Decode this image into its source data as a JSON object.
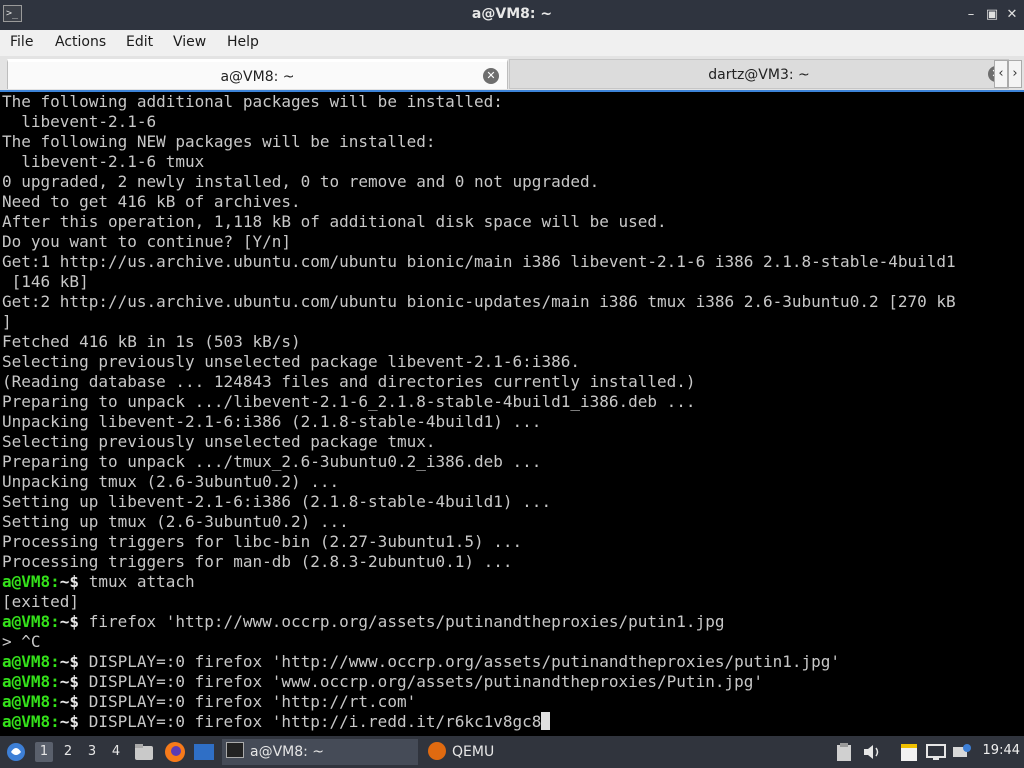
{
  "window": {
    "title": "a@VM8: ~",
    "app_icon_glyph": ">_",
    "minimize_glyph": "–",
    "maximize_glyph": "▣",
    "close_glyph": "✕"
  },
  "menu": {
    "items": [
      "File",
      "Actions",
      "Edit",
      "View",
      "Help"
    ]
  },
  "tabs": [
    {
      "label": "a@VM8: ~",
      "active": true,
      "close_glyph": "✕"
    },
    {
      "label": "dartz@VM3: ~",
      "active": false,
      "close_glyph": "✕"
    }
  ],
  "tab_scroll": {
    "left": "‹",
    "right": "›"
  },
  "terminal": {
    "prompt_label": "a@VM8:",
    "prompt_suffix": "~$",
    "lines": [
      {
        "type": "out",
        "text": "The following additional packages will be installed:"
      },
      {
        "type": "out",
        "text": "  libevent-2.1-6"
      },
      {
        "type": "out",
        "text": "The following NEW packages will be installed:"
      },
      {
        "type": "out",
        "text": "  libevent-2.1-6 tmux"
      },
      {
        "type": "out",
        "text": "0 upgraded, 2 newly installed, 0 to remove and 0 not upgraded."
      },
      {
        "type": "out",
        "text": "Need to get 416 kB of archives."
      },
      {
        "type": "out",
        "text": "After this operation, 1,118 kB of additional disk space will be used."
      },
      {
        "type": "out",
        "text": "Do you want to continue? [Y/n]"
      },
      {
        "type": "out",
        "text": "Get:1 http://us.archive.ubuntu.com/ubuntu bionic/main i386 libevent-2.1-6 i386 2.1.8-stable-4build1"
      },
      {
        "type": "out",
        "text": " [146 kB]"
      },
      {
        "type": "out",
        "text": "Get:2 http://us.archive.ubuntu.com/ubuntu bionic-updates/main i386 tmux i386 2.6-3ubuntu0.2 [270 kB"
      },
      {
        "type": "out",
        "text": "]"
      },
      {
        "type": "out",
        "text": "Fetched 416 kB in 1s (503 kB/s)"
      },
      {
        "type": "out",
        "text": "Selecting previously unselected package libevent-2.1-6:i386."
      },
      {
        "type": "out",
        "text": "(Reading database ... 124843 files and directories currently installed.)"
      },
      {
        "type": "out",
        "text": "Preparing to unpack .../libevent-2.1-6_2.1.8-stable-4build1_i386.deb ..."
      },
      {
        "type": "out",
        "text": "Unpacking libevent-2.1-6:i386 (2.1.8-stable-4build1) ..."
      },
      {
        "type": "out",
        "text": "Selecting previously unselected package tmux."
      },
      {
        "type": "out",
        "text": "Preparing to unpack .../tmux_2.6-3ubuntu0.2_i386.deb ..."
      },
      {
        "type": "out",
        "text": "Unpacking tmux (2.6-3ubuntu0.2) ..."
      },
      {
        "type": "out",
        "text": "Setting up libevent-2.1-6:i386 (2.1.8-stable-4build1) ..."
      },
      {
        "type": "out",
        "text": "Setting up tmux (2.6-3ubuntu0.2) ..."
      },
      {
        "type": "out",
        "text": "Processing triggers for libc-bin (2.27-3ubuntu1.5) ..."
      },
      {
        "type": "out",
        "text": "Processing triggers for man-db (2.8.3-2ubuntu0.1) ..."
      },
      {
        "type": "cmd",
        "text": " tmux attach"
      },
      {
        "type": "out",
        "text": "[exited]"
      },
      {
        "type": "cmd",
        "text": " firefox 'http://www.occrp.org/assets/putinandtheproxies/putin1.jpg"
      },
      {
        "type": "out",
        "text": "> ^C"
      },
      {
        "type": "cmd",
        "text": " DISPLAY=:0 firefox 'http://www.occrp.org/assets/putinandtheproxies/putin1.jpg'"
      },
      {
        "type": "cmd",
        "text": " DISPLAY=:0 firefox 'www.occrp.org/assets/putinandtheproxies/Putin.jpg'"
      },
      {
        "type": "cmd",
        "text": " DISPLAY=:0 firefox 'http://rt.com'"
      },
      {
        "type": "cmd",
        "text": " DISPLAY=:0 firefox 'http://i.redd.it/r6kc1v8gc8",
        "cursor": true
      }
    ]
  },
  "taskbar": {
    "workspaces": [
      "1",
      "2",
      "3",
      "4"
    ],
    "tasks": [
      {
        "label": "a@VM8: ~",
        "icon": "terminal-icon"
      },
      {
        "label": "QEMU",
        "icon": "qemu-icon"
      }
    ],
    "clock": "19:44"
  },
  "colors": {
    "prompt": "#34e21a",
    "terminal_bg": "#000000",
    "terminal_fg": "#c8c8c8",
    "accent": "#3c83d8"
  }
}
